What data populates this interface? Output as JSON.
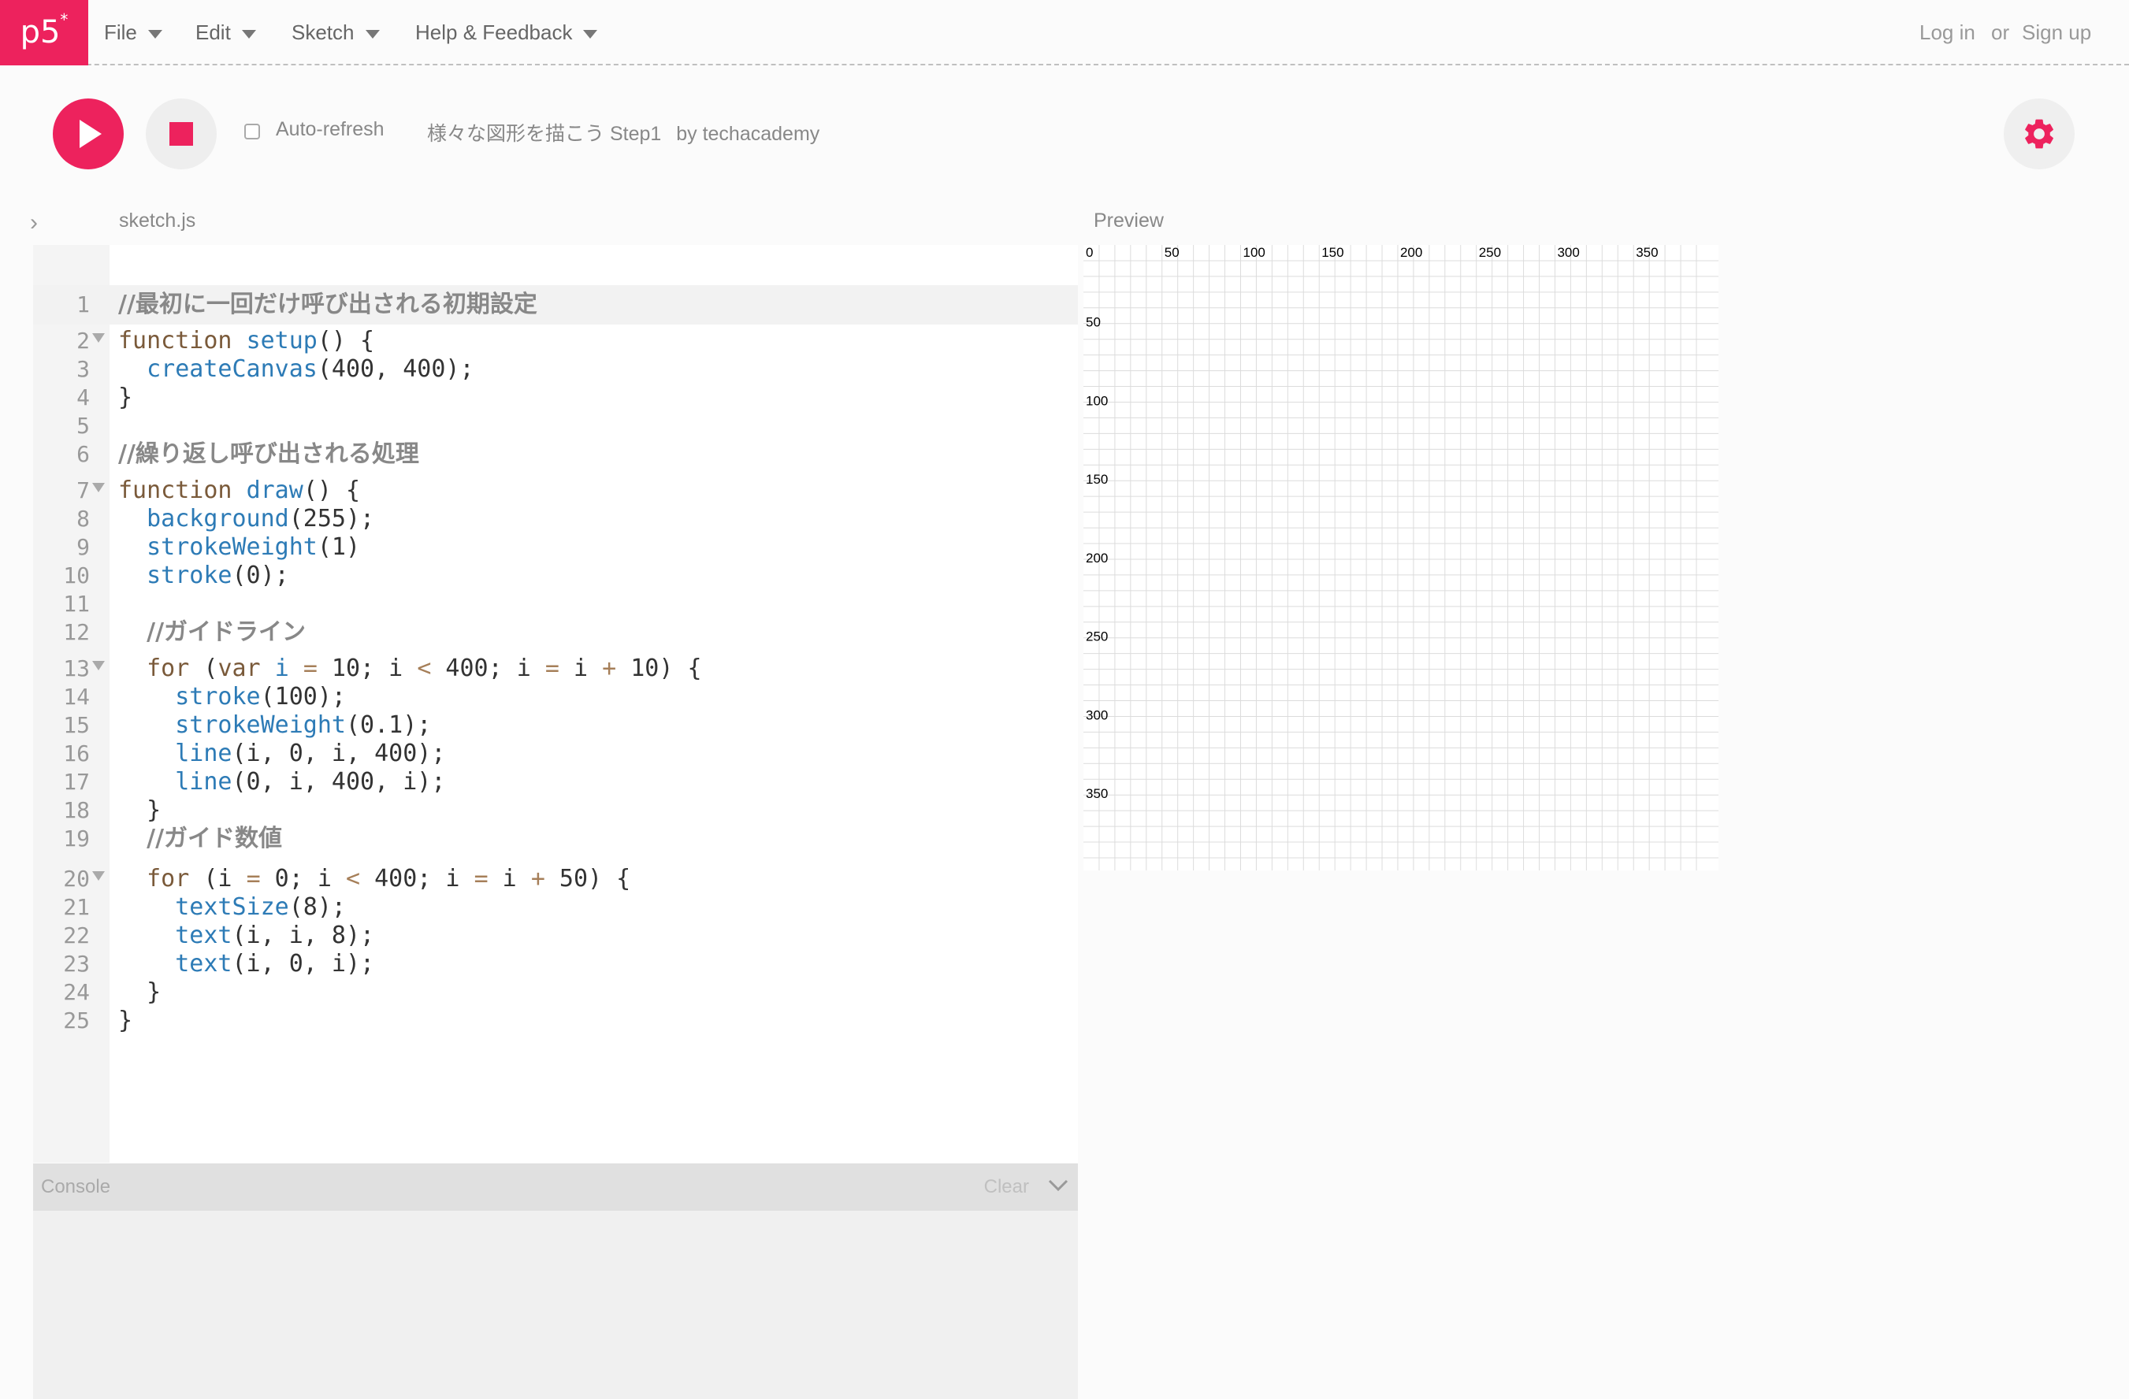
{
  "nav": {
    "logo": "p5",
    "logo_sup": "*",
    "menu": [
      "File",
      "Edit",
      "Sketch",
      "Help & Feedback"
    ],
    "login": "Log in",
    "or": "or",
    "signup": "Sign up"
  },
  "toolbar": {
    "auto_refresh_label": "Auto-refresh",
    "auto_refresh_checked": false,
    "sketch_name": "様々な図形を描こう Step1",
    "sketch_author": "by techacademy"
  },
  "editor": {
    "file_name": "sketch.js",
    "active_line": 1,
    "lines": [
      {
        "n": "1",
        "fold": false,
        "tokens": [
          [
            "cm",
            "//最初に一回だけ呼び出される初期設定"
          ]
        ]
      },
      {
        "n": "2",
        "fold": true,
        "tokens": [
          [
            "kw",
            "function"
          ],
          [
            "vr",
            " "
          ],
          [
            "fn",
            "setup"
          ],
          [
            "vr",
            "() {"
          ]
        ]
      },
      {
        "n": "3",
        "fold": false,
        "tokens": [
          [
            "vr",
            "  "
          ],
          [
            "bi",
            "createCanvas"
          ],
          [
            "vr",
            "(400, 400);"
          ]
        ]
      },
      {
        "n": "4",
        "fold": false,
        "tokens": [
          [
            "vr",
            "}"
          ]
        ]
      },
      {
        "n": "5",
        "fold": false,
        "tokens": []
      },
      {
        "n": "6",
        "fold": false,
        "tokens": [
          [
            "cm",
            "//繰り返し呼び出される処理"
          ]
        ]
      },
      {
        "n": "7",
        "fold": true,
        "tokens": [
          [
            "kw",
            "function"
          ],
          [
            "vr",
            " "
          ],
          [
            "fn",
            "draw"
          ],
          [
            "vr",
            "() {"
          ]
        ]
      },
      {
        "n": "8",
        "fold": false,
        "tokens": [
          [
            "vr",
            "  "
          ],
          [
            "bi",
            "background"
          ],
          [
            "vr",
            "(255);"
          ]
        ]
      },
      {
        "n": "9",
        "fold": false,
        "tokens": [
          [
            "vr",
            "  "
          ],
          [
            "bi",
            "strokeWeight"
          ],
          [
            "vr",
            "(1)"
          ]
        ]
      },
      {
        "n": "10",
        "fold": false,
        "tokens": [
          [
            "vr",
            "  "
          ],
          [
            "bi",
            "stroke"
          ],
          [
            "vr",
            "(0);"
          ]
        ]
      },
      {
        "n": "11",
        "fold": false,
        "tokens": []
      },
      {
        "n": "12",
        "fold": false,
        "tokens": [
          [
            "vr",
            "  "
          ],
          [
            "cm",
            "//ガイドライン"
          ]
        ]
      },
      {
        "n": "13",
        "fold": true,
        "tokens": [
          [
            "vr",
            "  "
          ],
          [
            "kw",
            "for"
          ],
          [
            "vr",
            " ("
          ],
          [
            "kw",
            "var"
          ],
          [
            "vr",
            " "
          ],
          [
            "fn",
            "i"
          ],
          [
            "vr",
            " "
          ],
          [
            "op",
            "="
          ],
          [
            "vr",
            " 10; i "
          ],
          [
            "op",
            "<"
          ],
          [
            "vr",
            " 400; i "
          ],
          [
            "op",
            "="
          ],
          [
            "vr",
            " i "
          ],
          [
            "op",
            "+"
          ],
          [
            "vr",
            " 10) {"
          ]
        ]
      },
      {
        "n": "14",
        "fold": false,
        "tokens": [
          [
            "vr",
            "    "
          ],
          [
            "bi",
            "stroke"
          ],
          [
            "vr",
            "(100);"
          ]
        ]
      },
      {
        "n": "15",
        "fold": false,
        "tokens": [
          [
            "vr",
            "    "
          ],
          [
            "bi",
            "strokeWeight"
          ],
          [
            "vr",
            "(0.1);"
          ]
        ]
      },
      {
        "n": "16",
        "fold": false,
        "tokens": [
          [
            "vr",
            "    "
          ],
          [
            "bi",
            "line"
          ],
          [
            "vr",
            "(i, 0, i, 400);"
          ]
        ]
      },
      {
        "n": "17",
        "fold": false,
        "tokens": [
          [
            "vr",
            "    "
          ],
          [
            "bi",
            "line"
          ],
          [
            "vr",
            "(0, i, 400, i);"
          ]
        ]
      },
      {
        "n": "18",
        "fold": false,
        "tokens": [
          [
            "vr",
            "  }"
          ]
        ]
      },
      {
        "n": "19",
        "fold": false,
        "tokens": [
          [
            "vr",
            "  "
          ],
          [
            "cm",
            "//ガイド数値"
          ]
        ]
      },
      {
        "n": "20",
        "fold": true,
        "tokens": [
          [
            "vr",
            "  "
          ],
          [
            "kw",
            "for"
          ],
          [
            "vr",
            " (i "
          ],
          [
            "op",
            "="
          ],
          [
            "vr",
            " 0; i "
          ],
          [
            "op",
            "<"
          ],
          [
            "vr",
            " 400; i "
          ],
          [
            "op",
            "="
          ],
          [
            "vr",
            " i "
          ],
          [
            "op",
            "+"
          ],
          [
            "vr",
            " 50) {"
          ]
        ]
      },
      {
        "n": "21",
        "fold": false,
        "tokens": [
          [
            "vr",
            "    "
          ],
          [
            "bi",
            "textSize"
          ],
          [
            "vr",
            "(8);"
          ]
        ]
      },
      {
        "n": "22",
        "fold": false,
        "tokens": [
          [
            "vr",
            "    "
          ],
          [
            "bi",
            "text"
          ],
          [
            "vr",
            "(i, i, 8);"
          ]
        ]
      },
      {
        "n": "23",
        "fold": false,
        "tokens": [
          [
            "vr",
            "    "
          ],
          [
            "bi",
            "text"
          ],
          [
            "vr",
            "(i, 0, i);"
          ]
        ]
      },
      {
        "n": "24",
        "fold": false,
        "tokens": [
          [
            "vr",
            "  }"
          ]
        ]
      },
      {
        "n": "25",
        "fold": false,
        "tokens": [
          [
            "vr",
            "}"
          ]
        ]
      }
    ]
  },
  "console": {
    "title": "Console",
    "clear_label": "Clear"
  },
  "preview": {
    "label": "Preview",
    "canvas_size": 400,
    "grid_step": 10,
    "label_step": 50,
    "x_labels": [
      "0",
      "50",
      "100",
      "150",
      "200",
      "250",
      "300",
      "350"
    ],
    "y_labels": [
      "50",
      "100",
      "150",
      "200",
      "250",
      "300",
      "350"
    ]
  },
  "colors": {
    "brand": "#ed225d",
    "keyword": "#7a5a3a",
    "builtin": "#2d7bb6",
    "operator": "#a67f59",
    "comment": "#888888"
  }
}
